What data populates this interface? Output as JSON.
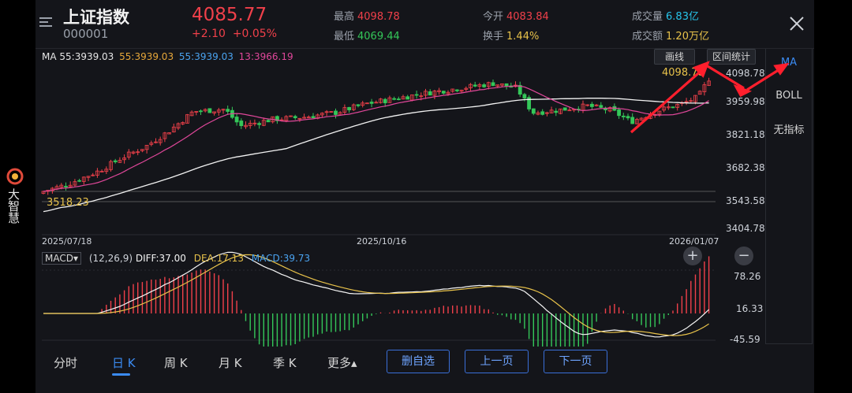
{
  "brand": {
    "name": "大智慧"
  },
  "header": {
    "name": "上证指数",
    "code": "000001",
    "price": "4085.77",
    "change": "+2.10",
    "change_pct": "+0.05%",
    "stats": {
      "high": {
        "label": "最高",
        "value": "4098.78"
      },
      "low": {
        "label": "最低",
        "value": "4069.44"
      },
      "open": {
        "label": "今开",
        "value": "4083.84"
      },
      "turnover": {
        "label": "换手",
        "value": "1.44%"
      },
      "volume": {
        "label": "成交量",
        "value": "6.83亿"
      },
      "amount": {
        "label": "成交额",
        "value": "1.20万亿"
      }
    }
  },
  "ma_legend": {
    "label": "MA 55:3939.03",
    "ma1": "55:3939.03",
    "ma2": "55:3939.03",
    "ma3": "13:3966.19"
  },
  "toolbar": {
    "draw": "画线",
    "range_stats": "区间统计"
  },
  "right_panel": {
    "items": [
      "MA",
      "BOLL",
      "无指标"
    ],
    "active": "MA"
  },
  "price_axis": [
    "4098.78",
    "3959.98",
    "3821.18",
    "3682.38",
    "3543.58",
    "3404.78"
  ],
  "date_axis": [
    "2025/07/18",
    "2025/10/16",
    "2026/01/07"
  ],
  "annotations": {
    "low_label": "3518.23",
    "high_label": "4098.78"
  },
  "macd": {
    "selector": "MACD",
    "params": "(12,26,9)",
    "diff": "DIFF:37.00",
    "dea": "DEA:17.13",
    "macd": "MACD:39.73",
    "axis": [
      "78.26",
      "16.33",
      "-45.59"
    ]
  },
  "tabs": {
    "items": [
      "分时",
      "日 K",
      "周 K",
      "月 K",
      "季 K",
      "更多▴"
    ],
    "active": "日 K"
  },
  "actions": {
    "remove_fav": "删自选",
    "prev_page": "上一页",
    "next_page": "下一页"
  },
  "colors": {
    "up": "#f0404a",
    "down": "#34c759",
    "ma_white": "#ffffff",
    "ma_pink": "#e0479a",
    "dea": "#e8c24a",
    "accent": "#3b8bf2"
  }
}
